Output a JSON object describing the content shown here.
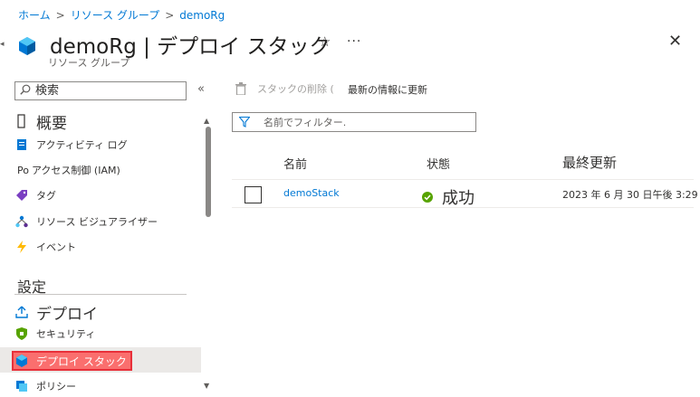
{
  "breadcrumb": {
    "home": "ホーム",
    "resource_groups": "リソース グループ",
    "current": "demoRg",
    "separator": ">"
  },
  "header": {
    "title": "demoRg | デプロイ スタック",
    "subtitle": "リソース グループ",
    "favorite_icon": "star-icon",
    "more_label": "...",
    "close_label": "✕"
  },
  "sidebar": {
    "search_placeholder": "検索",
    "collapse_label": "«",
    "items_top": [
      {
        "label": "概要",
        "icon": "overview-icon"
      },
      {
        "label": "アクティビティ ログ",
        "icon": "activity-log-icon"
      },
      {
        "label": "アクセス制御 (IAM)",
        "icon": "iam-icon",
        "prefix": "Po"
      },
      {
        "label": "タグ",
        "icon": "tag-icon"
      },
      {
        "label": "リソース ビジュアライザー",
        "icon": "visualizer-icon"
      },
      {
        "label": "イベント",
        "icon": "event-icon"
      }
    ],
    "section_settings": "設定",
    "items_settings": [
      {
        "label": "デプロイ",
        "icon": "deploy-icon"
      },
      {
        "label": "セキュリティ",
        "icon": "security-icon"
      },
      {
        "label": "デプロイ スタック",
        "icon": "deployment-stack-icon",
        "selected": true
      },
      {
        "label": "ポリシー",
        "icon": "policy-icon"
      }
    ]
  },
  "toolbar": {
    "delete_label": "スタックの削除 (",
    "refresh_label": "最新の情報に更新"
  },
  "filter": {
    "placeholder": "名前でフィルター."
  },
  "table": {
    "columns": [
      "名前",
      "状態",
      "最終更新"
    ],
    "rows": [
      {
        "name": "demoStack",
        "status": "成功",
        "last_updated": "2023 年 6 月 30 日午後 3:29"
      }
    ]
  },
  "colors": {
    "accent": "#0078d4",
    "success": "#57a300",
    "highlight": "#e8303a"
  }
}
